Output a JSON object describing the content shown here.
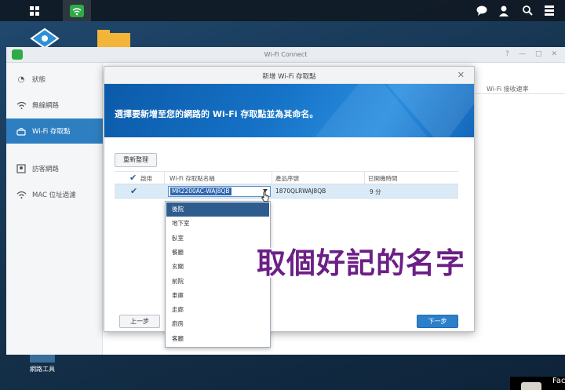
{
  "main_window": {
    "title": "Wi-Fi Connect",
    "controls": [
      "?",
      "—",
      "□",
      "✕"
    ],
    "sidebar": [
      {
        "label": "狀態",
        "icon": "status-icon"
      },
      {
        "label": "無線網路",
        "icon": "wifi-icon"
      },
      {
        "label": "Wi-Fi 存取點",
        "icon": "access-point-icon"
      },
      {
        "label": "訪客網路",
        "icon": "guest-network-icon"
      },
      {
        "label": "MAC 位址過濾",
        "icon": "mac-filter-icon"
      }
    ],
    "content_header": "Wi-Fi 接收速率"
  },
  "dialog": {
    "title": "新增 Wi-Fi 存取點",
    "banner_text": "選擇要新增至您的網路的 Wi-Fi 存取點並為其命名。",
    "refresh_label": "重新整理",
    "columns": [
      "啟用",
      "Wi-Fi 存取點名稱",
      "產品序號",
      "已開機時間"
    ],
    "row": {
      "name": "MR2200AC-WAJ8QB",
      "serial": "1870QLRWAJ8QB",
      "uptime": "9 分"
    },
    "dropdown_options": [
      "後院",
      "地下室",
      "臥室",
      "餐廳",
      "玄關",
      "前院",
      "車庫",
      "走廊",
      "廚房",
      "客廳"
    ],
    "prev_label": "上一步",
    "next_label": "下一步"
  },
  "desktop": {
    "tools_label": "網路工具",
    "facebook_text": "Face"
  },
  "overlay_caption": "取個好記的名字",
  "colors": {
    "accent": "#2e7fc1",
    "caption": "#6c1f86",
    "wifi_green": "#2eaa46"
  }
}
